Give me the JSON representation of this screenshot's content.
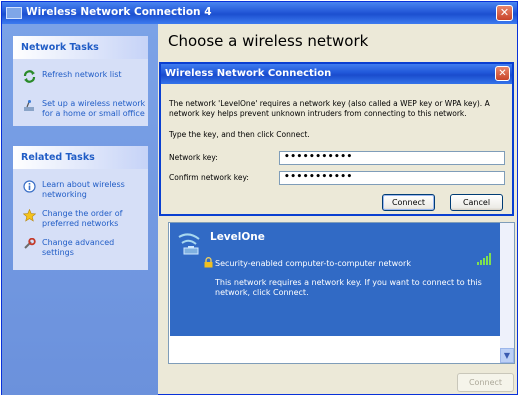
{
  "window": {
    "title": "Wireless Network Connection 4",
    "main_title": "Choose a wireless network",
    "close": "✕"
  },
  "network_tasks": {
    "heading": "Network Tasks",
    "items": [
      {
        "icon": "refresh-icon",
        "lines": [
          "Refresh network list"
        ]
      },
      {
        "icon": "setup-network-icon",
        "lines": [
          "Set up a wireless network",
          "for a home or small office"
        ]
      }
    ]
  },
  "related_tasks": {
    "heading": "Related Tasks",
    "items": [
      {
        "icon": "info-icon",
        "lines": [
          "Learn about wireless",
          "networking"
        ]
      },
      {
        "icon": "star-icon",
        "lines": [
          "Change the order of",
          "preferred networks"
        ]
      },
      {
        "icon": "settings-icon",
        "lines": [
          "Change advanced",
          "settings"
        ]
      }
    ]
  },
  "network": {
    "name": "LevelOne",
    "security": "Security-enabled computer-to-computer network",
    "message_lines": [
      "This network requires a network key. If you want to connect to this",
      "network, click Connect."
    ]
  },
  "bottom": {
    "connect_label": "Connect"
  },
  "dialog": {
    "title": "Wireless Network Connection",
    "close": "✕",
    "desc_lines": [
      "The network 'LevelOne' requires a network key (also called a WEP key or WPA key). A",
      "network key helps prevent unknown intruders from connecting to this network."
    ],
    "instruction": "Type the key, and then click Connect.",
    "network_key_label": "Network key:",
    "network_key_value": "•••••••••••",
    "confirm_key_label": "Confirm network key:",
    "confirm_key_value": "•••••••••••",
    "connect_label": "Connect",
    "cancel_label": "Cancel"
  },
  "colors": {
    "title_bar": "#2459d8",
    "selection": "#316ac5",
    "link": "#215dc6"
  }
}
